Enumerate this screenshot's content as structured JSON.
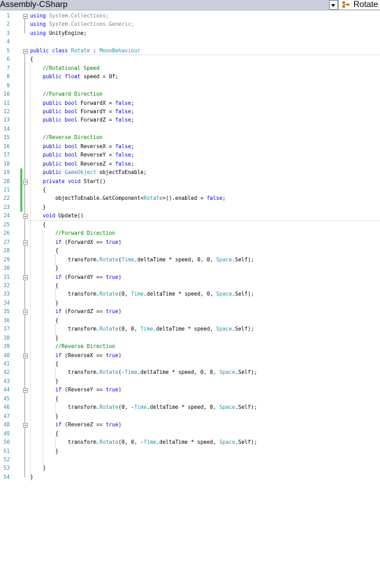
{
  "toolbar": {
    "assembly_label": "Assembly-CSharp",
    "member_label": "Rotate"
  },
  "editor": {
    "line_numbers": [
      "1",
      "2",
      "3",
      "4",
      "5",
      "6",
      "7",
      "8",
      "9",
      "10",
      "11",
      "12",
      "13",
      "14",
      "15",
      "16",
      "17",
      "18",
      "19",
      "20",
      "21",
      "22",
      "23",
      "24",
      "25",
      "26",
      "27",
      "28",
      "29",
      "30",
      "31",
      "32",
      "33",
      "34",
      "35",
      "36",
      "37",
      "38",
      "39",
      "40",
      "41",
      "42",
      "43",
      "44",
      "45",
      "46",
      "47",
      "48",
      "49",
      "50",
      "51",
      "52",
      "53",
      "54"
    ],
    "lines": [
      "using System.Collections;",
      "using System.Collections.Generic;",
      "using UnityEngine;",
      "",
      "public class Rotate : MonoBehaviour",
      "{",
      "    //Rotational Speed",
      "    public float speed = 0f;",
      "",
      "    //Forward Direction",
      "    public bool ForwardX = false;",
      "    public bool ForwardY = false;",
      "    public bool ForwardZ = false;",
      "",
      "    //Reverse Direction",
      "    public bool ReverseX = false;",
      "    public bool ReverseY = false;",
      "    public bool ReverseZ = false;",
      "    public GameObject objectToEnable;",
      "    private void Start()",
      "    {",
      "        objectToEnable.GetComponent<Rotate>().enabled = false;",
      "    }",
      "    void Update()",
      "    {",
      "        //Forward Direction",
      "        if (ForwardX == true)",
      "        {",
      "            transform.Rotate(Time.deltaTime * speed, 0, 0, Space.Self);",
      "        }",
      "        if (ForwardY == true)",
      "        {",
      "            transform.Rotate(0, Time.deltaTime * speed, 0, Space.Self);",
      "        }",
      "        if (ForwardZ == true)",
      "        {",
      "            transform.Rotate(0, 0, Time.deltaTime * speed, Space.Self);",
      "        }",
      "        //Reverse Direction",
      "        if (ReverseX == true)",
      "        {",
      "            transform.Rotate(-Time.deltaTime * speed, 0, 0, Space.Self);",
      "        }",
      "        if (ReverseY == true)",
      "        {",
      "            transform.Rotate(0, -Time.deltaTime * speed, 0, Space.Self);",
      "        }",
      "        if (ReverseZ == true)",
      "        {",
      "            transform.Rotate(0, 0, -Time.deltaTime * speed, Space.Self);",
      "        }",
      "",
      "    }",
      "}"
    ]
  },
  "colors": {
    "keyword": "#0000ff",
    "type": "#2b91af",
    "comment": "#008000",
    "line_number": "#2b91af",
    "change_marker": "#57c65d"
  }
}
